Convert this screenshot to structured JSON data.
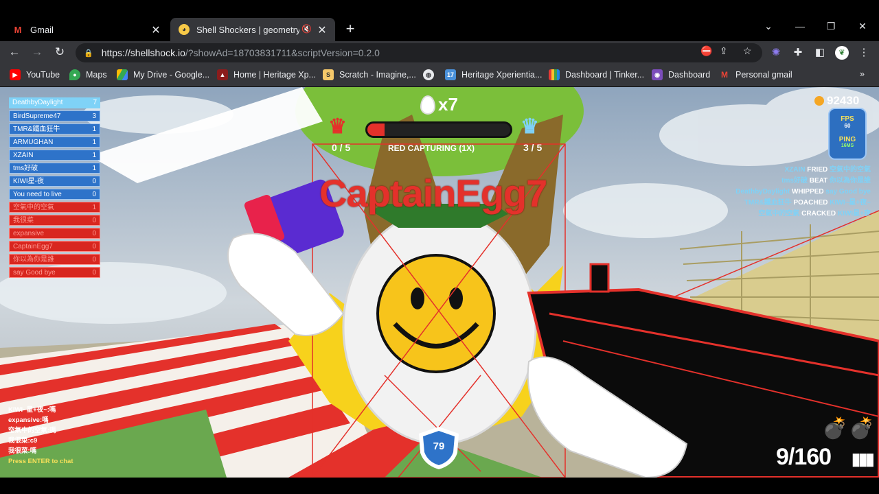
{
  "browser": {
    "tabs": [
      {
        "title": "Gmail",
        "icon": "gmail-icon",
        "active": false
      },
      {
        "title": "Shell Shockers | geometry.m",
        "icon": "shellshock-icon",
        "active": true
      }
    ],
    "url_host": "https://shellshock.io",
    "url_path": "/?showAd=18703831711&scriptVersion=0.2.0",
    "bookmarks": [
      "YouTube",
      "Maps",
      "My Drive - Google...",
      "Home | Heritage Xp...",
      "Scratch - Imagine,...",
      "Heritage Xperientia...",
      "Dashboard | Tinker...",
      "Dashboard",
      "Personal gmail"
    ]
  },
  "hud": {
    "eggs_count": "x7",
    "coins": "92430",
    "fps_label": "FPS",
    "fps_value": "60",
    "ping_label": "PING",
    "ping_value": "16MS",
    "capture_status": "RED CAPTURING (1X)",
    "red_score": "0 / 5",
    "blue_score": "3 / 5",
    "capture_progress": 0.12,
    "enemy_name": "CaptainEgg7",
    "shield_value": "79",
    "ammo": "9/160",
    "grenades": 2
  },
  "leaderboard": [
    {
      "name": "DeathbyDaylight",
      "score": "7",
      "team": "first"
    },
    {
      "name": "BirdSupreme47",
      "score": "3",
      "team": "blue"
    },
    {
      "name": "TMR&鐵血狂牛",
      "score": "1",
      "team": "blue"
    },
    {
      "name": "ARMUGHAN",
      "score": "1",
      "team": "blue"
    },
    {
      "name": "XZAIN",
      "score": "1",
      "team": "blue"
    },
    {
      "name": "tms好破",
      "score": "1",
      "team": "blue"
    },
    {
      "name": "KIWI星-夜",
      "score": "0",
      "team": "blue"
    },
    {
      "name": "You need to live",
      "score": "0",
      "team": "blue"
    },
    {
      "name": "空氣中的空氣",
      "score": "1",
      "team": "red"
    },
    {
      "name": "我很菜",
      "score": "0",
      "team": "red"
    },
    {
      "name": "expansive",
      "score": "0",
      "team": "red"
    },
    {
      "name": "CaptainEgg7",
      "score": "0",
      "team": "red"
    },
    {
      "name": "你以為你是誰",
      "score": "0",
      "team": "red"
    },
    {
      "name": "say Good bye",
      "score": "0",
      "team": "red"
    }
  ],
  "killfeed": [
    {
      "killer": "XZAIN",
      "verb": "FRIED",
      "victim": "空氣中的空氣"
    },
    {
      "killer": "tms好破",
      "verb": "BEAT",
      "victim": "你以為你是誰"
    },
    {
      "killer": "DeathbyDaylight",
      "verb": "WHIPPED",
      "victim": "say Good bye"
    },
    {
      "killer": "TMR&鐵血狂牛",
      "verb": "POACHED",
      "victim": "KIWI~星+夜~"
    },
    {
      "killer": "空氣中的空氣",
      "verb": "CRACKED",
      "victim": "KIWI星+夜"
    }
  ],
  "chat": [
    {
      "name": "KIWI~星+夜~",
      "msg": "嗎"
    },
    {
      "name": "expansive",
      "msg": "嗎"
    },
    {
      "name": "空氣中的空氣",
      "msg": "嗎"
    },
    {
      "name": "我很菜",
      "msg": "c9"
    },
    {
      "name": "我很菜",
      "msg": "嗎"
    }
  ],
  "chat_hint": "Press ENTER to chat"
}
